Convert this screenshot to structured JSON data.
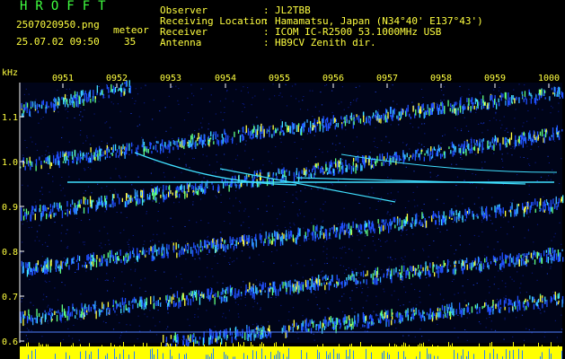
{
  "header": {
    "logo": "HROFFT",
    "filename": "2507020950.png",
    "datetime": "25.07.02 09:50",
    "meteor_label": "meteor",
    "meteor_count": "35",
    "fields": [
      {
        "label": "Observer",
        "value": "JL2TBB"
      },
      {
        "label": "Receiving Location",
        "value": "Hamamatsu, Japan (N34°40' E137°43')"
      },
      {
        "label": "Receiver",
        "value": "ICOM IC-R2500 53.1000MHz USB"
      },
      {
        "label": "Antenna",
        "value": "HB9CV Zenith dir."
      }
    ]
  },
  "spectrogram": {
    "y_unit": "kHz",
    "y_ticks": [
      "1.1",
      "1.0",
      "0.9",
      "0.8",
      "0.7",
      "0.6"
    ],
    "x_ticks": [
      "0951",
      "0952",
      "0953",
      "0954",
      "0955",
      "0956",
      "0957",
      "0958",
      "0959",
      "1000"
    ],
    "colors": {
      "background": "#000000",
      "text": "#ffff40",
      "logo": "#40ff40",
      "carrier": "#40e0ff",
      "amplitude": "#ffff00"
    }
  }
}
